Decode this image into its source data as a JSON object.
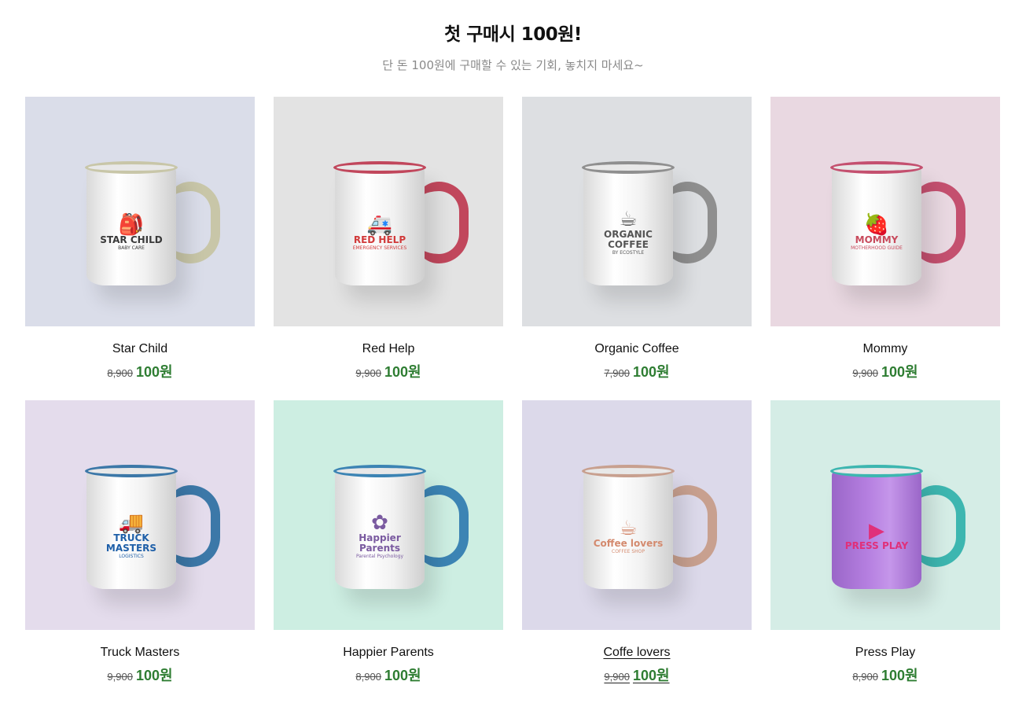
{
  "header": {
    "title": "첫 구매시 100원!",
    "subtitle": "단 돈 100원에 구매할 수 있는 기회, 놓치지 마세요~"
  },
  "products": [
    {
      "name": "Star Child",
      "original_price": "8,900",
      "sale_price": "100원",
      "bg": "#dadde9",
      "accent": "#c8c6a8",
      "logo": {
        "line1": "STAR CHILD",
        "line2": "BABY CARE",
        "icon": "backpack-icon",
        "color": "#3a3a3a"
      }
    },
    {
      "name": "Red Help",
      "original_price": "9,900",
      "sale_price": "100원",
      "bg": "#e3e3e3",
      "accent": "#c1475c",
      "logo": {
        "line1": "RED HELP",
        "line2": "EMERGENCY SERVICES",
        "icon": "ambulance-icon",
        "color": "#d13a3a"
      }
    },
    {
      "name": "Organic Coffee",
      "original_price": "7,900",
      "sale_price": "100원",
      "bg": "#dddfe2",
      "accent": "#8f8f8f",
      "logo": {
        "line1": "ORGANIC COFFEE",
        "line2": "BY ECOSTYLE",
        "icon": "coffee-branch-icon",
        "color": "#555555"
      }
    },
    {
      "name": "Mommy",
      "original_price": "9,900",
      "sale_price": "100원",
      "bg": "#e9d8e1",
      "accent": "#c4506f",
      "logo": {
        "line1": "MOMMY",
        "line2": "MOTHERHOOD GUIDE",
        "icon": "strawberry-icon",
        "color": "#c84a5c"
      }
    },
    {
      "name": "Truck Masters",
      "original_price": "9,900",
      "sale_price": "100원",
      "bg": "#e4dcec",
      "accent": "#3c78a8",
      "logo": {
        "line1": "TRUCK MASTERS",
        "line2": "LOGISTICS",
        "icon": "truck-icon",
        "color": "#1e5fa8"
      }
    },
    {
      "name": "Happier Parents",
      "original_price": "8,900",
      "sale_price": "100원",
      "bg": "#cdeee2",
      "accent": "#3c84b4",
      "logo": {
        "line1": "Happier Parents",
        "line2": "Parental Psychology",
        "icon": "flower-icon",
        "color": "#7a5aa0"
      }
    },
    {
      "name": "Coffe lovers",
      "original_price": "9,900",
      "sale_price": "100원",
      "bg": "#dcd9ea",
      "accent": "#c8a08f",
      "logo": {
        "line1": "Coffee lovers",
        "line2": "COFFEE SHOP",
        "icon": "grinder-icon",
        "color": "#d48a6e"
      }
    },
    {
      "name": "Press Play",
      "original_price": "8,900",
      "sale_price": "100원",
      "bg": "#d5ede6",
      "accent": "#3db6b0",
      "mug_color": "#b57fe0",
      "logo": {
        "line1": "PRESS PLAY",
        "line2": "",
        "icon": "play-icon",
        "color": "#e0307a"
      }
    }
  ],
  "hovered_index": 6
}
